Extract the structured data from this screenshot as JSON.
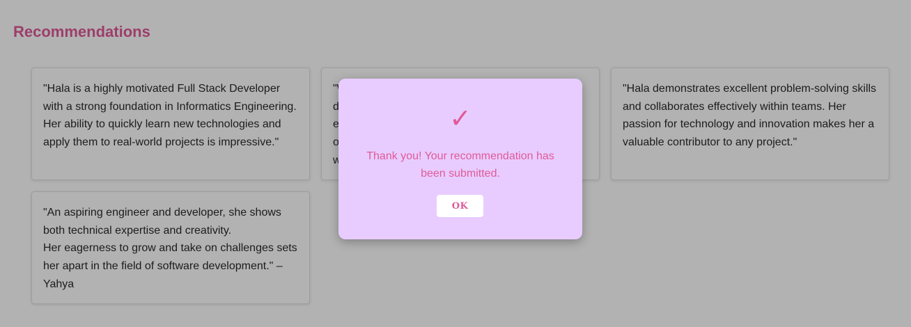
{
  "section": {
    "title": "Recommendations"
  },
  "recommendations": [
    {
      "text": "\"Hala is a highly motivated Full Stack Developer with a strong foundation in Informatics Engineering. Her ability to quickly learn new technologies and apply them to real-world projects is impressive.\""
    },
    {
      "text": "\"W\nd\ne\no\nw"
    },
    {
      "text": "\"Hala demonstrates excellent problem-solving skills and collaborates effectively within teams. Her passion for technology and innovation makes her a valuable contributor to any project.\""
    },
    {
      "text": "\"An aspiring engineer and developer, she shows both technical expertise and creativity.\nHer eagerness to grow and take on challenges sets her apart in the field of software development.\" – Yahya"
    }
  ],
  "modal": {
    "icon": "checkmark-icon",
    "icon_glyph": "✓",
    "message": "Thank you! Your recommendation has been submitted.",
    "ok_label": "OK"
  },
  "colors": {
    "accent": "#e05a99",
    "modal_background": "#e8ccff",
    "overlay": "rgba(0,0,0,0.30)"
  }
}
